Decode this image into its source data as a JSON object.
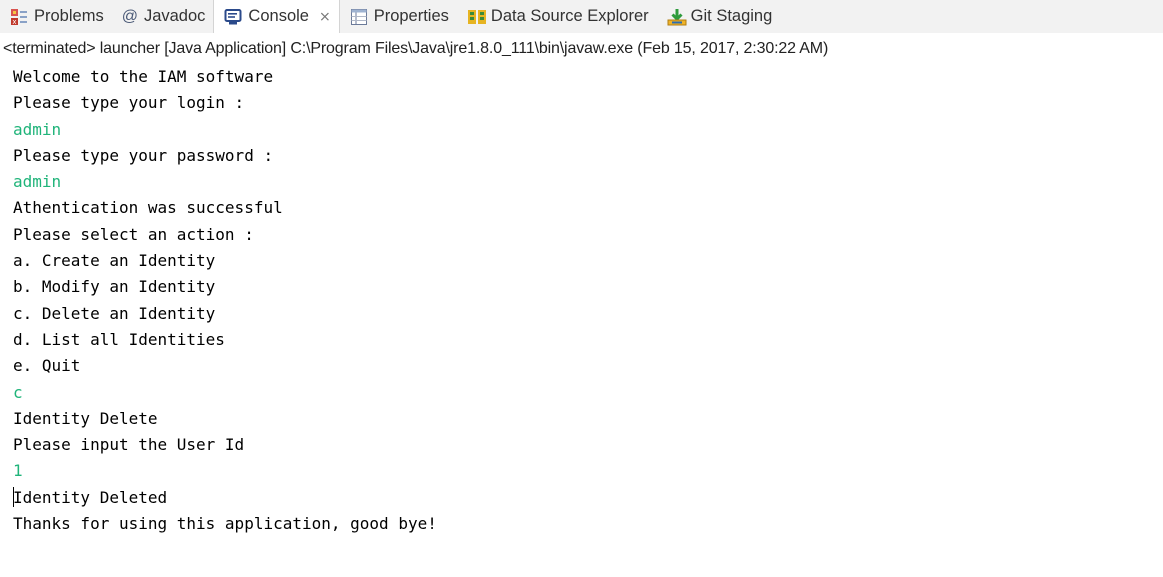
{
  "tabs": [
    {
      "label": "Problems",
      "icon": "problems-icon",
      "active": false
    },
    {
      "label": "Javadoc",
      "icon": "javadoc-icon",
      "active": false
    },
    {
      "label": "Console",
      "icon": "console-icon",
      "active": true
    },
    {
      "label": "Properties",
      "icon": "properties-icon",
      "active": false
    },
    {
      "label": "Data Source Explorer",
      "icon": "data-source-explorer-icon",
      "active": false
    },
    {
      "label": "Git Staging",
      "icon": "git-staging-icon",
      "active": false
    }
  ],
  "console": {
    "status": "<terminated> launcher [Java Application] C:\\Program Files\\Java\\jre1.8.0_111\\bin\\javaw.exe (Feb 15, 2017, 2:30:22 AM)",
    "input_color": "#20b47a",
    "lines": [
      {
        "text": "Welcome to the IAM software",
        "input": false
      },
      {
        "text": "Please type your login :",
        "input": false
      },
      {
        "text": "admin",
        "input": true
      },
      {
        "text": "Please type your password :",
        "input": false
      },
      {
        "text": "admin",
        "input": true
      },
      {
        "text": "Athentication was successful",
        "input": false
      },
      {
        "text": "Please select an action :",
        "input": false
      },
      {
        "text": "a. Create an Identity",
        "input": false
      },
      {
        "text": "b. Modify an Identity",
        "input": false
      },
      {
        "text": "c. Delete an Identity",
        "input": false
      },
      {
        "text": "d. List all Identities",
        "input": false
      },
      {
        "text": "e. Quit",
        "input": false
      },
      {
        "text": "c",
        "input": true
      },
      {
        "text": "Identity Delete",
        "input": false
      },
      {
        "text": "Please input the User Id",
        "input": false
      },
      {
        "text": "1",
        "input": true
      },
      {
        "text": "Identity Deleted",
        "input": false
      },
      {
        "text": "Thanks for using this application, good bye!",
        "input": false
      }
    ]
  }
}
